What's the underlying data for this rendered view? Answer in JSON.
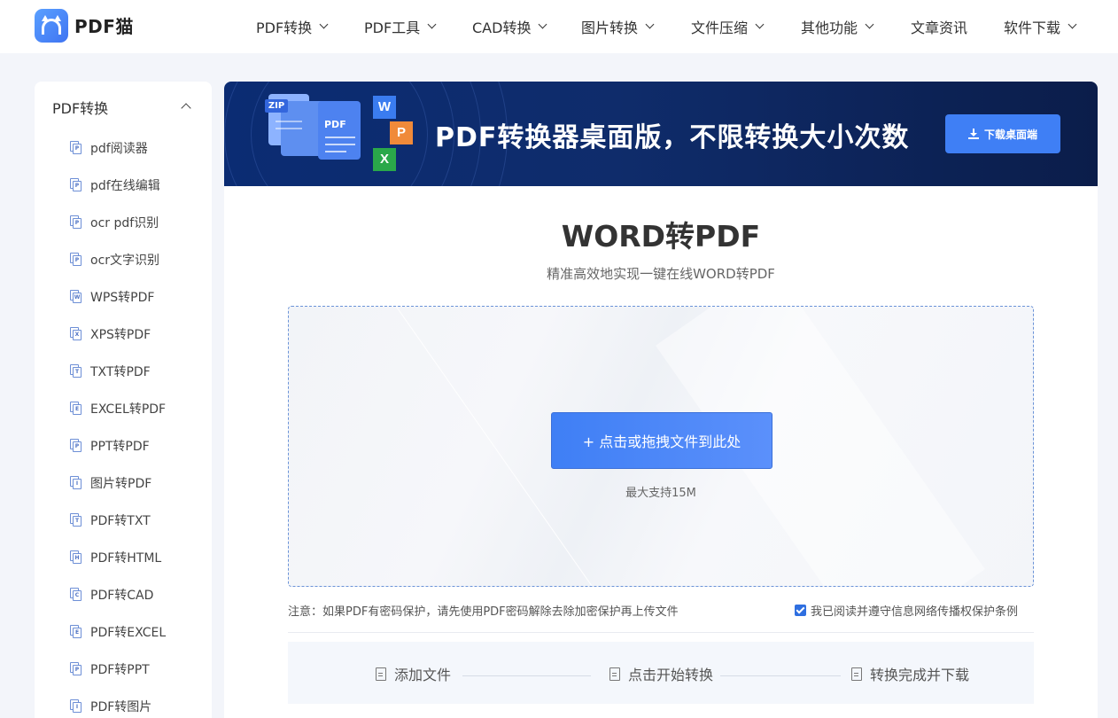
{
  "brand": {
    "name": "PDF猫"
  },
  "nav": [
    {
      "label": "PDF转换",
      "has_menu": true
    },
    {
      "label": "PDF工具",
      "has_menu": true
    },
    {
      "label": "CAD转换",
      "has_menu": true
    },
    {
      "label": "图片转换",
      "has_menu": true
    },
    {
      "label": "文件压缩",
      "has_menu": true
    },
    {
      "label": "其他功能",
      "has_menu": true
    },
    {
      "label": "文章资讯",
      "has_menu": false
    },
    {
      "label": "软件下载",
      "has_menu": true
    }
  ],
  "sidebar": {
    "title": "PDF转换",
    "expanded": true,
    "items": [
      {
        "label": "pdf阅读器",
        "icon": "P"
      },
      {
        "label": "pdf在线编辑",
        "icon": "P"
      },
      {
        "label": "ocr pdf识别",
        "icon": "P"
      },
      {
        "label": "ocr文字识别",
        "icon": "P"
      },
      {
        "label": "WPS转PDF",
        "icon": "W"
      },
      {
        "label": "XPS转PDF",
        "icon": "X"
      },
      {
        "label": "TXT转PDF",
        "icon": "T"
      },
      {
        "label": "EXCEL转PDF",
        "icon": "E"
      },
      {
        "label": "PPT转PDF",
        "icon": "P"
      },
      {
        "label": "图片转PDF",
        "icon": "I"
      },
      {
        "label": "PDF转TXT",
        "icon": "T"
      },
      {
        "label": "PDF转HTML",
        "icon": "H"
      },
      {
        "label": "PDF转CAD",
        "icon": "C"
      },
      {
        "label": "PDF转EXCEL",
        "icon": "E"
      },
      {
        "label": "PDF转PPT",
        "icon": "P"
      },
      {
        "label": "PDF转图片",
        "icon": "I"
      }
    ]
  },
  "banner": {
    "zip_tag": "ZIP",
    "pdf_tag": "PDF",
    "badges": [
      "W",
      "P",
      "X"
    ],
    "title": "PDF转换器桌面版，不限转换大小次数",
    "button_label": "下载桌面端"
  },
  "main": {
    "title": "WORD转PDF",
    "subtitle": "精准高效地实现一键在线WORD转PDF",
    "upload_button": "+ 点击或拖拽文件到此处",
    "size_limit": "最大支持15M",
    "notice": "注意：如果PDF有密码保护，请先使用PDF密码解除去除加密保护再上传文件",
    "agree_label": "我已阅读并遵守信息网络传播权保护条例",
    "agree_checked": true
  },
  "steps": [
    "添加文件",
    "点击开始转换",
    "转换完成并下载"
  ],
  "colors": {
    "accent": "#3f7ff5",
    "banner_bg": "#0b2c73",
    "page_bg": "#f3f5fa"
  }
}
